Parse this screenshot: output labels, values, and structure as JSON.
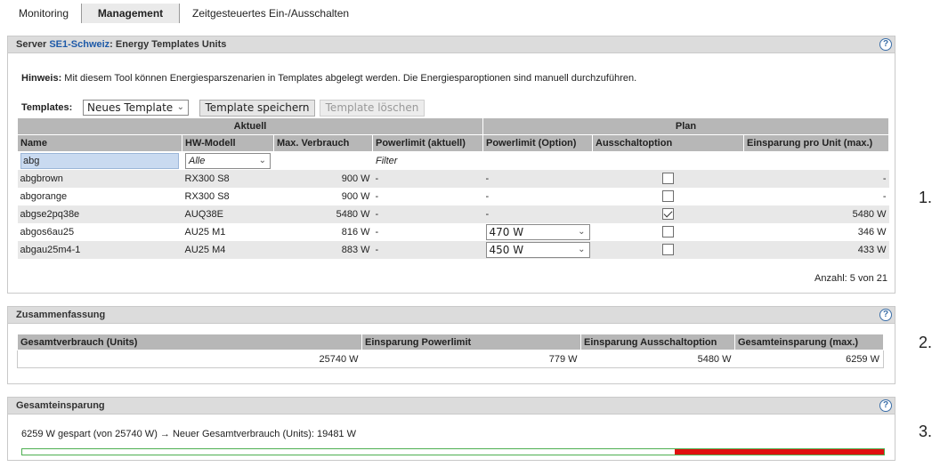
{
  "tabs": [
    {
      "label": "Monitoring"
    },
    {
      "label": "Management"
    },
    {
      "label": "Zeitgesteuertes Ein-/Ausschalten"
    }
  ],
  "panel1": {
    "title_prefix": "Server ",
    "server_name": "SE1-Schweiz",
    "title_suffix": ": Energy Templates Units",
    "hint_label": "Hinweis:",
    "hint_text": " Mit diesem Tool können Energiesparszenarien in Templates abgelegt werden. Die Energiesparoptionen sind manuell durchzuführen.",
    "templates_label": "Templates:",
    "templates_selected": "Neues Template",
    "save_button": "Template speichern",
    "delete_button": "Template löschen",
    "group_headers": {
      "aktuell": "Aktuell",
      "plan": "Plan"
    },
    "columns": [
      "Name",
      "HW-Modell",
      "Max. Verbrauch",
      "Powerlimit (aktuell)",
      "Powerlimit (Option)",
      "Ausschaltoption",
      "Einsparung pro Unit (max.)"
    ],
    "filter": {
      "name": "abg",
      "hw": "Alle",
      "powerlimit": "Filter"
    },
    "rows": [
      {
        "name": "abgbrown",
        "hw": "RX300 S8",
        "max": "900 W",
        "pl_current": "-",
        "pl_option": "-",
        "pl_option_select": false,
        "off_checked": false,
        "saving": "-"
      },
      {
        "name": "abgorange",
        "hw": "RX300 S8",
        "max": "900 W",
        "pl_current": "-",
        "pl_option": "-",
        "pl_option_select": false,
        "off_checked": false,
        "saving": "-"
      },
      {
        "name": "abgse2pq38e",
        "hw": "AUQ38E",
        "max": "5480 W",
        "pl_current": "-",
        "pl_option": "-",
        "pl_option_select": false,
        "off_checked": true,
        "saving": "5480 W"
      },
      {
        "name": "abgos6au25",
        "hw": "AU25 M1",
        "max": "816 W",
        "pl_current": "-",
        "pl_option": "470 W",
        "pl_option_select": true,
        "off_checked": false,
        "saving": "346 W"
      },
      {
        "name": "abgau25m4-1",
        "hw": "AU25 M4",
        "max": "883 W",
        "pl_current": "-",
        "pl_option": "450 W",
        "pl_option_select": true,
        "off_checked": false,
        "saving": "433 W"
      }
    ],
    "count": "Anzahl: 5 von 21"
  },
  "panel2": {
    "title": "Zusammenfassung",
    "columns": [
      "Gesamtverbrauch (Units)",
      "Einsparung Powerlimit",
      "Einsparung Ausschaltoption",
      "Gesamteinsparung (max.)"
    ],
    "values": [
      "25740 W",
      "779 W",
      "5480 W",
      "6259 W"
    ]
  },
  "panel3": {
    "title": "Gesamteinsparung",
    "text": "6259 W gespart (von 25740 W) → Neuer Gesamtverbrauch (Units): 19481 W",
    "saved_fraction": 0.243
  },
  "side_numbers": [
    "1.",
    "2.",
    "3."
  ],
  "help_icon": "?",
  "colors": {
    "bar_red": "#e01010",
    "bar_border": "#4caf50",
    "server_link": "#1e5aa8",
    "filter_highlight": "#c9daf0"
  }
}
